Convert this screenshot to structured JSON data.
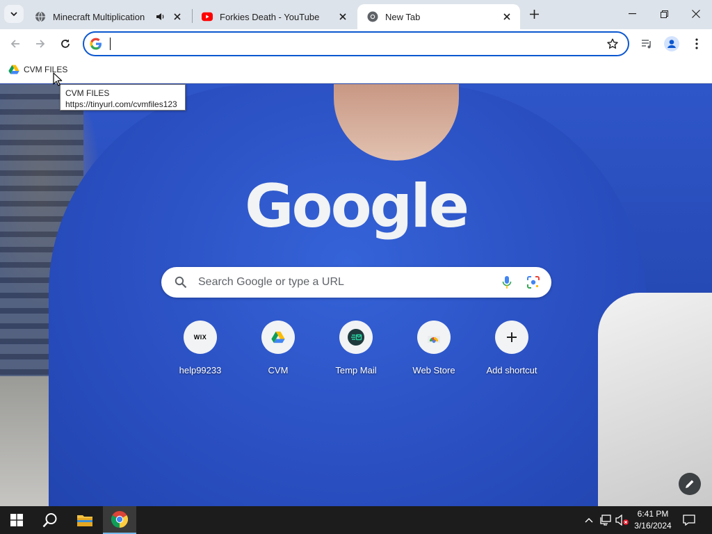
{
  "browser": {
    "tabs": [
      {
        "title": "Minecraft Multiplication",
        "favicon": "globe-icon",
        "audio": "speaker-icon",
        "active": false
      },
      {
        "title": "Forkies Death - YouTube",
        "favicon": "youtube-icon",
        "active": false
      },
      {
        "title": "New Tab",
        "favicon": "chrome-icon",
        "active": true
      }
    ],
    "address_bar": {
      "value": "",
      "placeholder": ""
    },
    "bookmarks": [
      {
        "label": "CVM FILES",
        "favicon": "google-drive-icon"
      }
    ],
    "tooltip": {
      "title": "CVM FILES",
      "url": "https://tinyurl.com/cvmfiles123"
    }
  },
  "ntp": {
    "logo_text": "Google",
    "search_placeholder": "Search Google or type a URL",
    "shortcuts": [
      {
        "label": "help99233",
        "icon": "wix-icon",
        "icon_text": "WIX"
      },
      {
        "label": "CVM",
        "icon": "google-drive-icon"
      },
      {
        "label": "Temp Mail",
        "icon": "temp-mail-icon"
      },
      {
        "label": "Web Store",
        "icon": "web-store-icon"
      },
      {
        "label": "Add shortcut",
        "icon": "plus-icon"
      }
    ]
  },
  "taskbar": {
    "time": "6:41 PM",
    "date": "3/16/2024"
  },
  "colors": {
    "accent": "#0b57d0",
    "tabstrip": "#dde3ea",
    "taskbar": "#1c1c1c"
  }
}
